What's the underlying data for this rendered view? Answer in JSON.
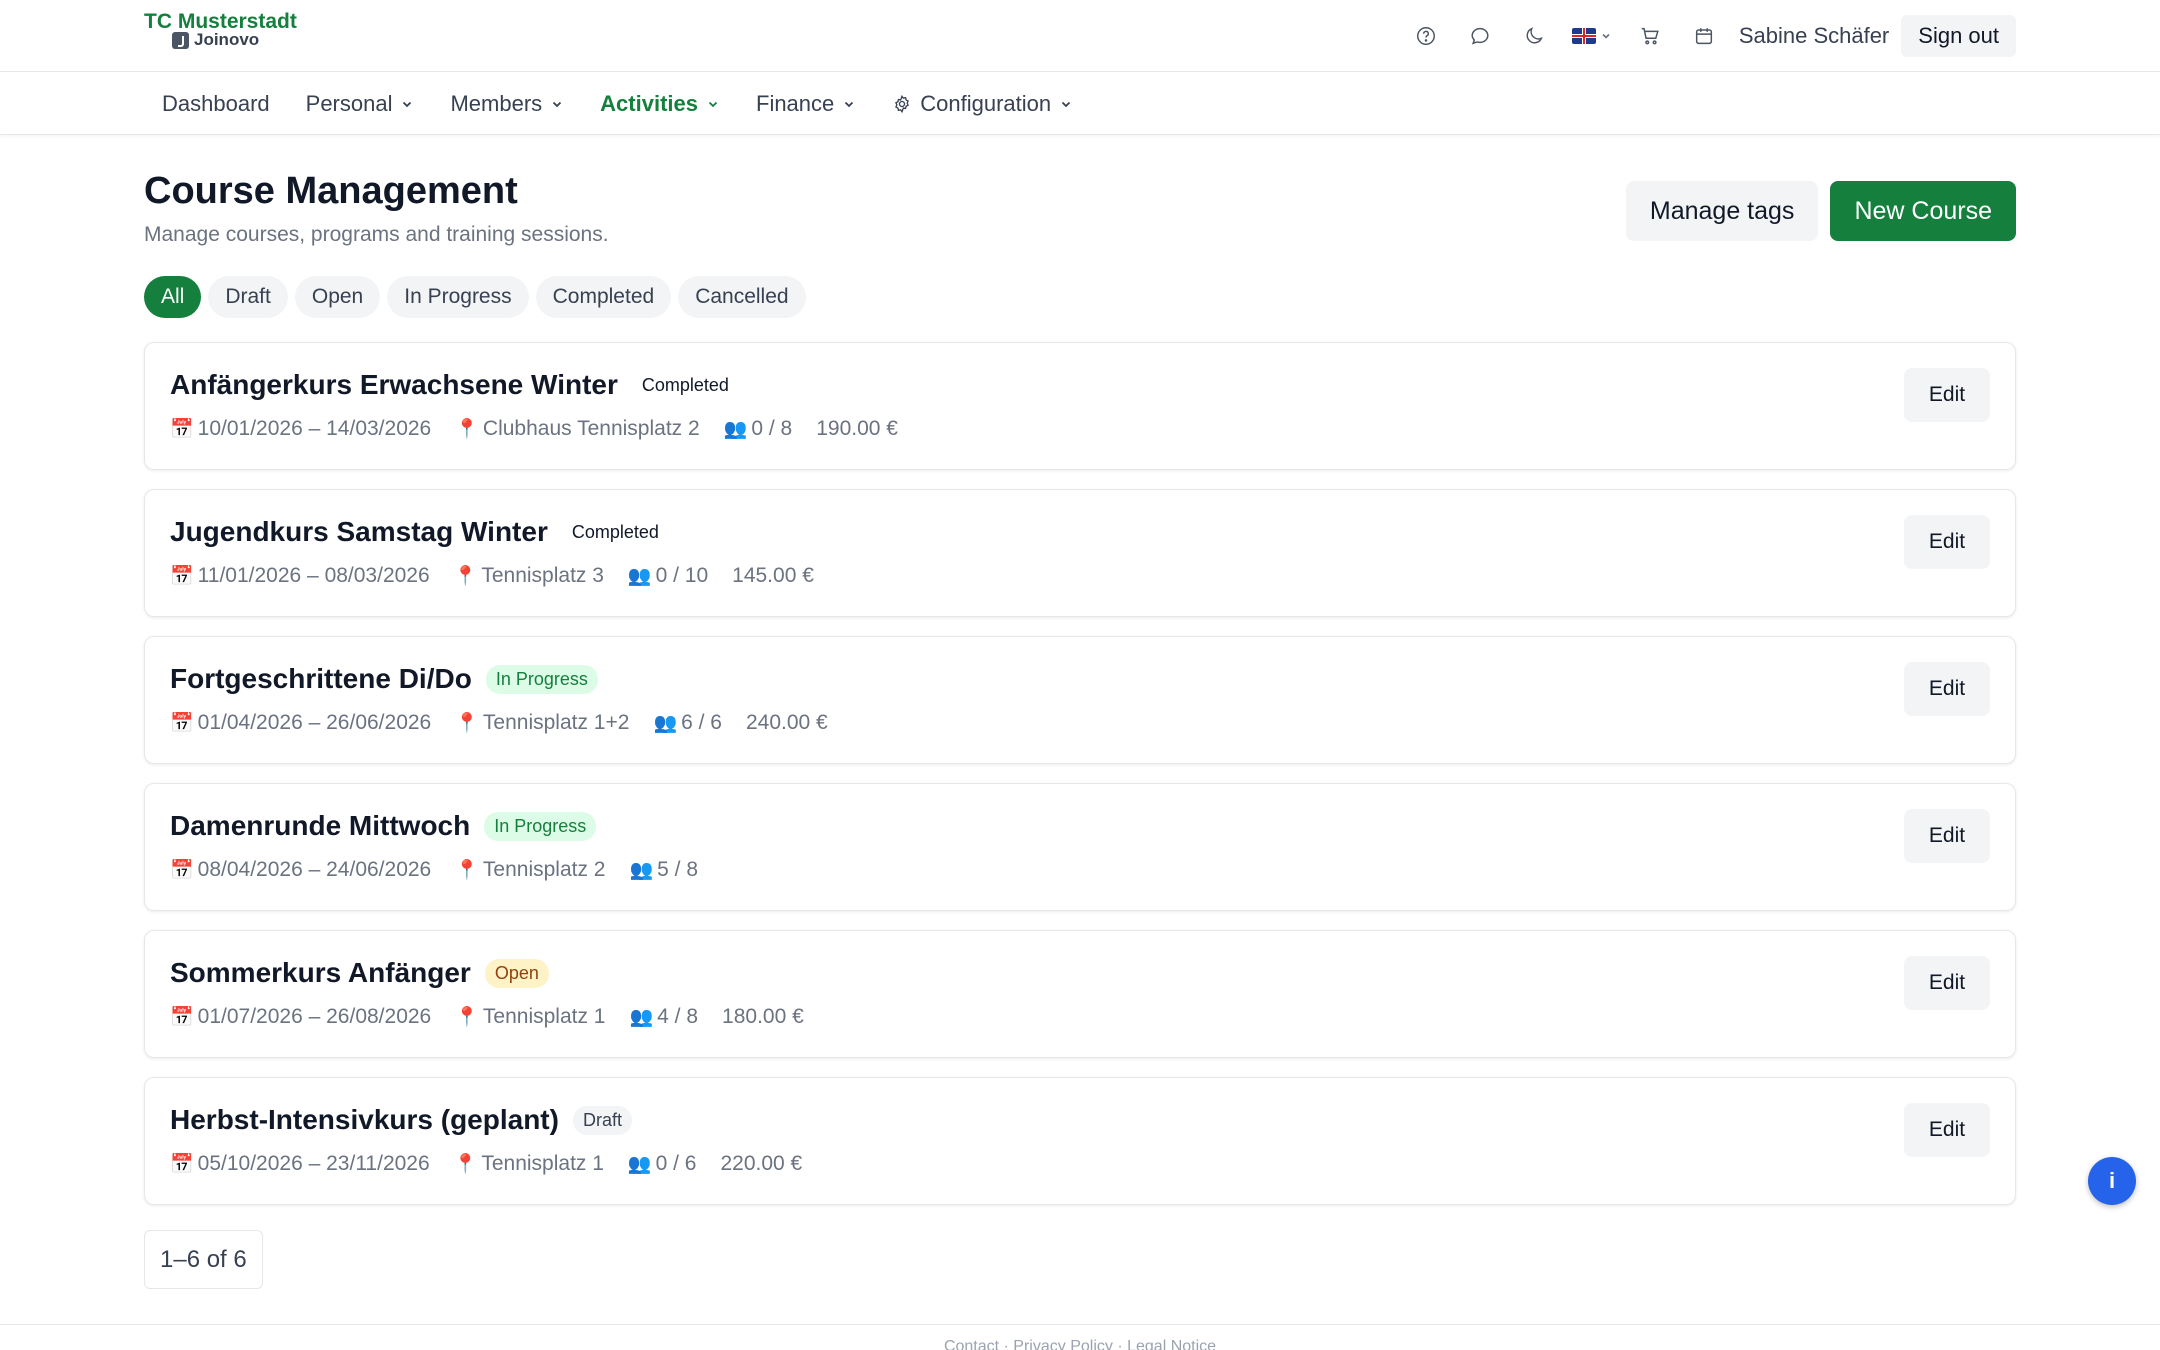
{
  "header": {
    "brand": "TC Musterstadt",
    "brand_sub": "Joinovo",
    "user_name": "Sabine Schäfer",
    "signout_label": "Sign out",
    "icons": [
      "help-circle-icon",
      "chat-bubble-icon",
      "moon-icon",
      "uk-flag-icon",
      "cart-icon",
      "calendar-icon"
    ]
  },
  "nav": {
    "items": [
      {
        "label": "Dashboard"
      },
      {
        "label": "Personal"
      },
      {
        "label": "Members"
      },
      {
        "label": "Activities",
        "active": true
      },
      {
        "label": "Finance"
      },
      {
        "label": "Configuration"
      }
    ]
  },
  "page": {
    "title": "Course Management",
    "subtitle": "Manage courses, programs and training sessions.",
    "manage_tags_label": "Manage tags",
    "new_course_label": "New Course"
  },
  "filters": [
    "All",
    "Draft",
    "Open",
    "In Progress",
    "Completed",
    "Cancelled"
  ],
  "active_filter": "All",
  "courses": [
    {
      "name": "Anfängerkurs Erwachsene Winter",
      "status": "Completed",
      "dates": "10/01/2026 – 14/03/2026",
      "location": "Clubhaus Tennisplatz 2",
      "participants": "0 / 8",
      "price": "190.00 €",
      "edit_label": "Edit"
    },
    {
      "name": "Jugendkurs Samstag Winter",
      "status": "Completed",
      "dates": "11/01/2026 – 08/03/2026",
      "location": "Tennisplatz 3",
      "participants": "0 / 10",
      "price": "145.00 €",
      "edit_label": "Edit"
    },
    {
      "name": "Fortgeschrittene Di/Do",
      "status": "In Progress",
      "dates": "01/04/2026 – 26/06/2026",
      "location": "Tennisplatz 1+2",
      "participants": "6 / 6",
      "price": "240.00 €",
      "edit_label": "Edit"
    },
    {
      "name": "Damenrunde Mittwoch",
      "status": "In Progress",
      "dates": "08/04/2026 – 24/06/2026",
      "location": "Tennisplatz 2",
      "participants": "5 / 8",
      "price": "",
      "edit_label": "Edit"
    },
    {
      "name": "Sommerkurs Anfänger",
      "status": "Open",
      "dates": "01/07/2026 – 26/08/2026",
      "location": "Tennisplatz 1",
      "participants": "4 / 8",
      "price": "180.00 €",
      "edit_label": "Edit"
    },
    {
      "name": "Herbst-Intensivkurs (geplant)",
      "status": "Draft",
      "dates": "05/10/2026 – 23/11/2026",
      "location": "Tennisplatz 1",
      "participants": "0 / 6",
      "price": "220.00 €",
      "edit_label": "Edit"
    }
  ],
  "pagination": {
    "label": "1–6 of 6"
  },
  "footer": {
    "text": "Contact · Privacy Policy · Legal Notice"
  },
  "info_fab": {
    "label": "i"
  },
  "colors": {
    "accent": "#15803d",
    "fab": "#2563eb"
  }
}
